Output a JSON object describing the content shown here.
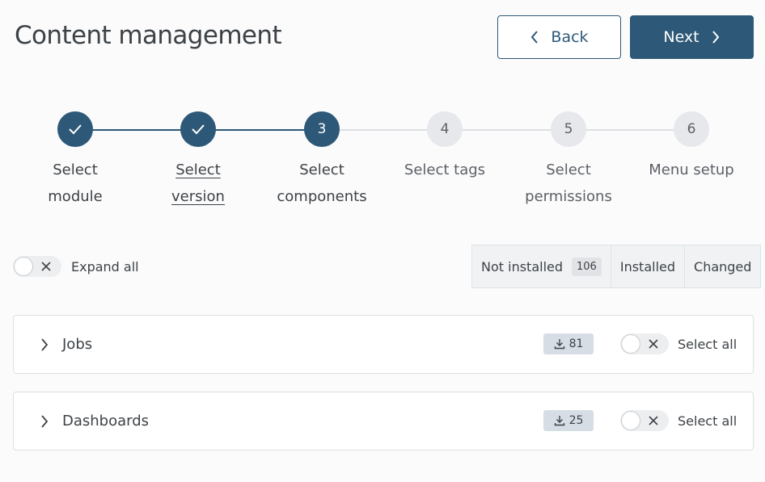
{
  "header": {
    "title": "Content management",
    "back_label": "Back",
    "next_label": "Next"
  },
  "colors": {
    "primary": "#2d5877",
    "step_todo": "#e6e8eb",
    "badge_bg": "#d7dde5"
  },
  "steps": [
    {
      "number": "1",
      "label": "Select\nmodule",
      "state": "done"
    },
    {
      "number": "2",
      "label": "Select\nversion",
      "state": "done"
    },
    {
      "number": "3",
      "label": "Select\ncomponents",
      "state": "active"
    },
    {
      "number": "4",
      "label": "Select tags",
      "state": "todo"
    },
    {
      "number": "5",
      "label": "Select\npermissions",
      "state": "todo"
    },
    {
      "number": "6",
      "label": "Menu setup",
      "state": "todo"
    }
  ],
  "toolbar": {
    "expand_all_label": "Expand all",
    "filters": [
      {
        "label": "Not installed",
        "count": "106"
      },
      {
        "label": "Installed"
      },
      {
        "label": "Changed"
      }
    ]
  },
  "groups": [
    {
      "title": "Jobs",
      "download_count": "81",
      "select_all_label": "Select all"
    },
    {
      "title": "Dashboards",
      "download_count": "25",
      "select_all_label": "Select all"
    }
  ],
  "icons": {
    "back": "chevron-left-icon",
    "next": "chevron-right-icon",
    "done": "check-icon",
    "toggle_off": "close-icon",
    "expand": "chevron-right-icon",
    "download": "download-icon"
  }
}
